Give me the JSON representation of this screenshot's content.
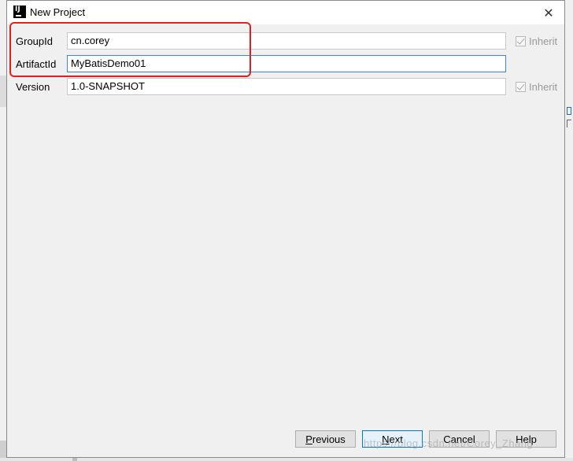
{
  "window": {
    "title": "New Project",
    "app_icon_letters": "IJ"
  },
  "form": {
    "group_id": {
      "label": "GroupId",
      "value": "cn.corey",
      "inherit_label": "Inherit",
      "inherit_checked": true
    },
    "artifact_id": {
      "label": "ArtifactId",
      "value": "MyBatisDemo01"
    },
    "version": {
      "label": "Version",
      "value": "1.0-SNAPSHOT",
      "inherit_label": "Inherit",
      "inherit_checked": true
    }
  },
  "buttons": {
    "previous": {
      "mnemonic": "P",
      "rest": "revious"
    },
    "next": {
      "mnemonic": "N",
      "rest": "ext"
    },
    "cancel": "Cancel",
    "help": "Help"
  },
  "watermark": "https://blog.csdn.net/Corey_Zhang",
  "colors": {
    "focus_border": "#3d87d8",
    "highlight_box": "#e02020",
    "default_button_border": "#0078d7"
  }
}
